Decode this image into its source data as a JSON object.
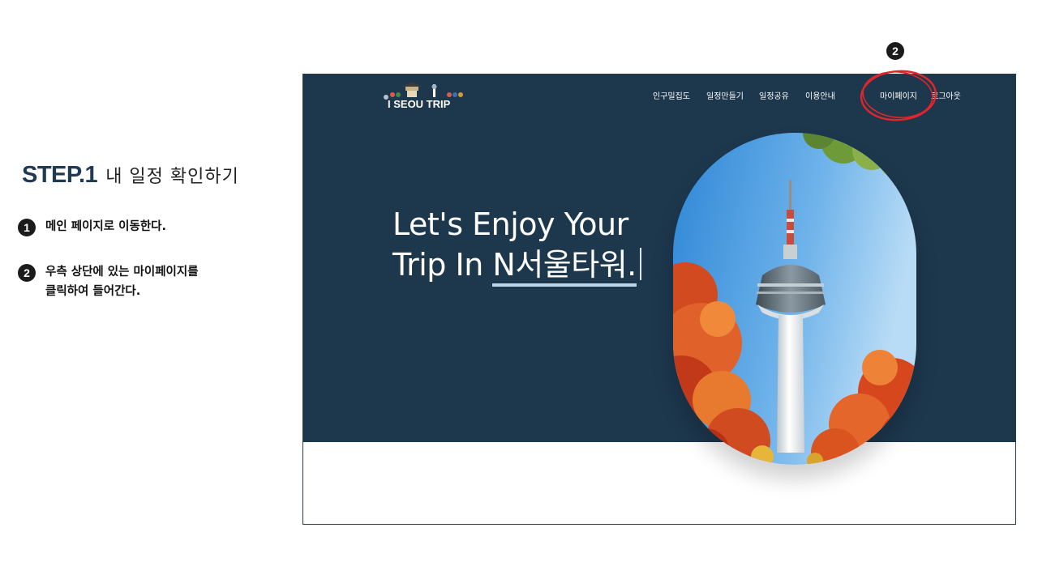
{
  "step": {
    "number": "STEP.1",
    "title": "내 일정 확인하기"
  },
  "instructions": [
    {
      "badge": "1",
      "lines": [
        "메인 페이지로 이동한다."
      ]
    },
    {
      "badge": "2",
      "lines": [
        "우측 상단에 있는 마이페이지를",
        "클릭하여 들어간다."
      ]
    }
  ],
  "callout": {
    "badge": "2",
    "target": "마이페이지"
  },
  "site": {
    "logo_text": "I SEOUL TRIP",
    "nav": [
      "인구밀집도",
      "일정만들기",
      "일정공유",
      "이용안내",
      "마이페이지",
      "로그아웃"
    ],
    "hero": {
      "line1": "Let's Enjoy Your",
      "line2_prefix": "Trip In ",
      "line2_highlight": "N서울타워."
    }
  },
  "colors": {
    "hero_bg": "#1d374d",
    "step_title": "#1f3a52",
    "underline": "#b9d6ea",
    "callout_ring": "#e0262b"
  }
}
